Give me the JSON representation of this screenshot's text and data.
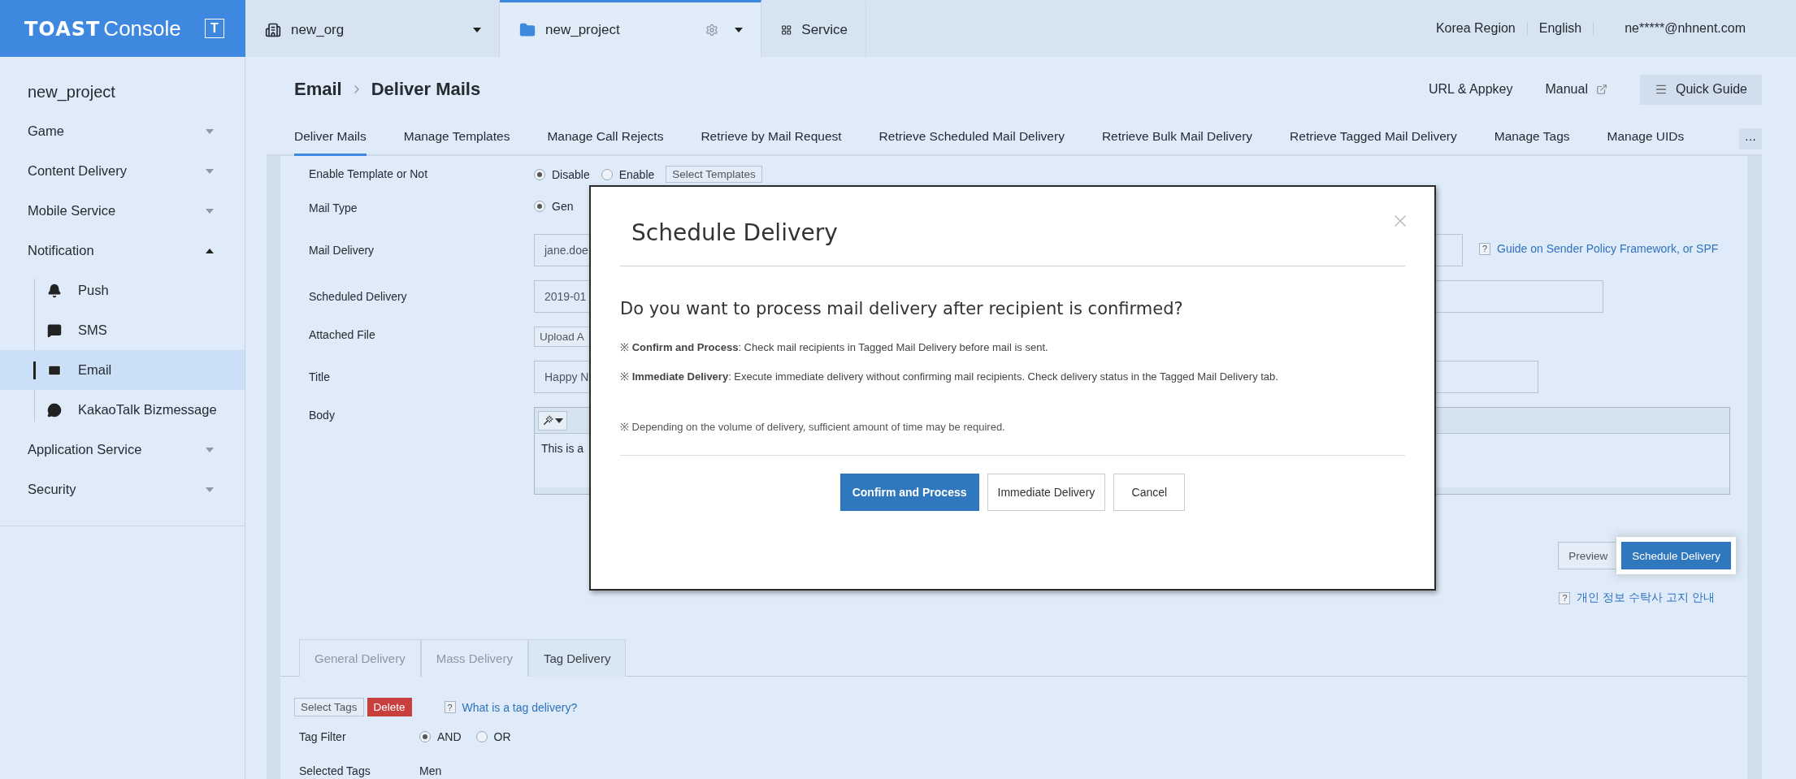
{
  "logo": {
    "brand": "TOAST",
    "product": "Console",
    "badge": "T"
  },
  "top_tabs": [
    {
      "kind": "org",
      "label": "new_org",
      "selected": false
    },
    {
      "kind": "project",
      "label": "new_project",
      "selected": true
    },
    {
      "kind": "service",
      "label": "Service",
      "selected": false
    }
  ],
  "top_links": [
    "Korea Region",
    "English",
    "ne*****@nhnent.com"
  ],
  "sidebar": {
    "project": "new_project",
    "items": [
      {
        "label": "Game",
        "expanded": false
      },
      {
        "label": "Content Delivery",
        "expanded": false
      },
      {
        "label": "Mobile Service",
        "expanded": false
      },
      {
        "label": "Notification",
        "expanded": true,
        "children": [
          {
            "label": "Push",
            "selected": false
          },
          {
            "label": "SMS",
            "selected": false
          },
          {
            "label": "Email",
            "selected": true
          },
          {
            "label": "KakaoTalk Bizmessage",
            "selected": false
          }
        ]
      },
      {
        "label": "Application Service",
        "expanded": false
      },
      {
        "label": "Security",
        "expanded": false
      }
    ]
  },
  "breadcrumb": [
    "Email",
    "Deliver Mails"
  ],
  "header_actions": [
    {
      "kind": "link",
      "label": "URL & Appkey"
    },
    {
      "kind": "external",
      "label": "Manual"
    },
    {
      "kind": "guide",
      "label": "Quick Guide"
    }
  ],
  "tabs": [
    {
      "label": "Deliver Mails",
      "selected": true
    },
    {
      "label": "Manage Templates",
      "selected": false
    },
    {
      "label": "Manage Call Rejects",
      "selected": false
    },
    {
      "label": "Retrieve by Mail Request",
      "selected": false
    },
    {
      "label": "Retrieve Scheduled Mail Delivery",
      "selected": false
    },
    {
      "label": "Retrieve Bulk Mail Delivery",
      "selected": false
    },
    {
      "label": "Retrieve Tagged Mail Delivery",
      "selected": false
    },
    {
      "label": "Manage Tags",
      "selected": false
    },
    {
      "label": "Manage UIDs",
      "selected": false
    }
  ],
  "more_tabs": "···",
  "form": [
    {
      "label": "Enable Template or Not",
      "kind": "radios",
      "options": [
        {
          "label": "Disable",
          "selected": true
        },
        {
          "label": "Enable",
          "selected": false
        }
      ],
      "button": "Select Templates"
    },
    {
      "label": "Mail Type",
      "kind": "radios",
      "options": [
        {
          "label": "Gen",
          "selected": true
        }
      ]
    },
    {
      "label": "Mail Delivery",
      "kind": "input",
      "value": "jane.doe",
      "help": "?",
      "link": "Guide on Sender Policy Framework, or SPF"
    },
    {
      "label": "Scheduled Delivery",
      "kind": "input",
      "value": "2019-01"
    },
    {
      "label": "Attached File",
      "kind": "upload",
      "value": "Upload A"
    },
    {
      "label": "Title",
      "kind": "input",
      "value": "Happy N"
    },
    {
      "label": "Body",
      "kind": "editor",
      "value": "This is a"
    }
  ],
  "actions": [
    {
      "label": "Preview",
      "kind": "default",
      "highlighted": false
    },
    {
      "label": "Schedule Delivery",
      "kind": "primary",
      "highlighted": true
    }
  ],
  "notice": {
    "help": "?",
    "link": "개인 정보 수탁사 고지 안내"
  },
  "delivery_tabs": [
    {
      "label": "General Delivery",
      "selected": false
    },
    {
      "label": "Mass Delivery",
      "selected": false
    },
    {
      "label": "Tag Delivery",
      "selected": true
    }
  ],
  "tag_section": {
    "buttons": [
      {
        "label": "Select Tags",
        "kind": "default"
      },
      {
        "label": "Delete",
        "kind": "danger"
      }
    ],
    "help": "?",
    "link": "What is a tag delivery?",
    "rows": [
      {
        "label": "Tag Filter",
        "kind": "radios",
        "options": [
          {
            "label": "AND",
            "selected": true
          },
          {
            "label": "OR",
            "selected": false
          }
        ]
      },
      {
        "label": "Selected Tags",
        "kind": "text",
        "value": "Men"
      }
    ]
  },
  "modal": {
    "title": "Schedule Delivery",
    "question": "Do you want to process mail delivery after recipient is confirmed?",
    "notes": [
      "※ **Confirm and Process**: Check mail recipients in Tagged Mail Delivery before mail is sent.",
      "※ **Immediate Delivery**: Execute immediate delivery without confirming mail recipients. Check delivery status in the Tagged Mail Delivery tab."
    ],
    "footnote": "※ Depending on the volume of delivery, sufficient amount of time may be required.",
    "buttons": [
      {
        "label": "Confirm and Process",
        "kind": "primary"
      },
      {
        "label": "Immediate Delivery",
        "kind": "default"
      },
      {
        "label": "Cancel",
        "kind": "default"
      }
    ]
  }
}
